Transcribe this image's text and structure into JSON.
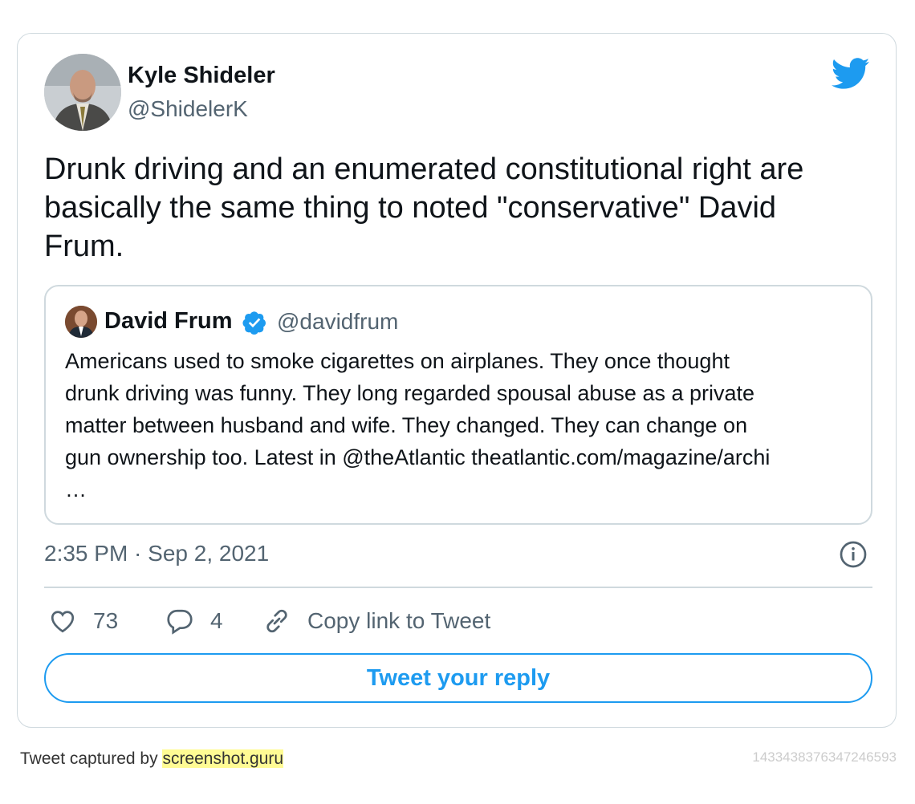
{
  "tweet": {
    "author_name": "Kyle Shideler",
    "author_handle": "@ShidelerK",
    "text": "Drunk driving and an enumerated constitutional right are basically the same thing to noted \"conservative\" David Frum.",
    "timestamp": "2:35 PM · Sep 2, 2021"
  },
  "quote": {
    "author_name": "David Frum",
    "author_handle": "@davidfrum",
    "text_lines": [
      "Americans used to smoke cigarettes on airplanes. They once thought",
      "drunk driving was funny. They long regarded spousal abuse as a private",
      "matter between husband and wife. They changed. They can change on",
      "gun ownership too. Latest in @theAtlantic theatlantic.com/magazine/archi",
      "…"
    ]
  },
  "actions": {
    "like_count": "73",
    "reply_count": "4",
    "copy_label": "Copy link to Tweet"
  },
  "reply_button": "Tweet your reply",
  "footer": {
    "prefix": "Tweet captured by ",
    "site": "screenshot.guru",
    "tweet_id": "1433438376347246593"
  },
  "colors": {
    "twitter_blue": "#1d9bf0",
    "secondary_text": "#536471",
    "border": "#cfd9de"
  }
}
